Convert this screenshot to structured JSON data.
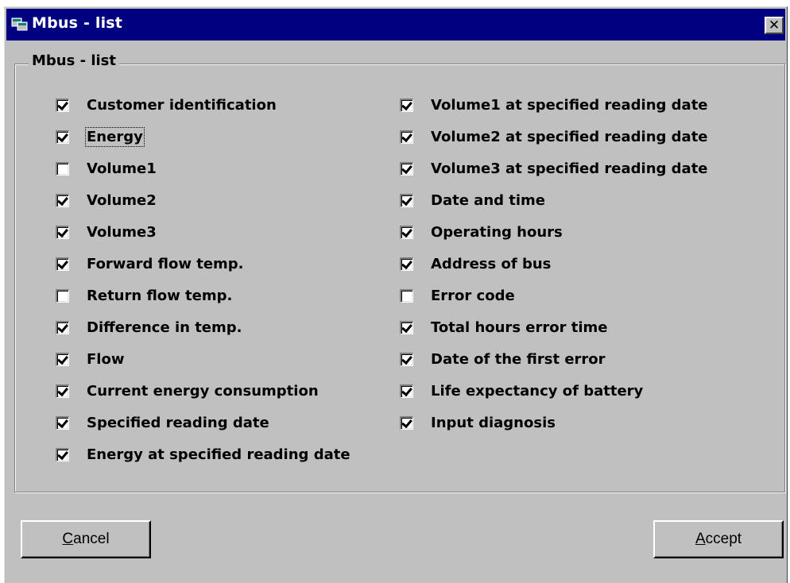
{
  "window": {
    "title": "Mbus - list",
    "icon": "app-window-icon",
    "close_label": "✕"
  },
  "group": {
    "label": "Mbus - list"
  },
  "left_column": [
    {
      "label": "Customer identification",
      "checked": true
    },
    {
      "label": "Energy",
      "checked": true,
      "focused": true
    },
    {
      "label": "Volume1",
      "checked": false
    },
    {
      "label": "Volume2",
      "checked": true
    },
    {
      "label": "Volume3",
      "checked": true
    },
    {
      "label": "Forward flow temp.",
      "checked": true
    },
    {
      "label": "Return flow temp.",
      "checked": false
    },
    {
      "label": "Difference in temp.",
      "checked": true
    },
    {
      "label": "Flow",
      "checked": true
    },
    {
      "label": "Current energy consumption",
      "checked": true
    },
    {
      "label": "Specified reading date",
      "checked": true
    },
    {
      "label": "Energy at specified reading date",
      "checked": true
    }
  ],
  "right_column": [
    {
      "label": "Volume1 at specified reading date",
      "checked": true
    },
    {
      "label": "Volume2 at specified reading date",
      "checked": true
    },
    {
      "label": "Volume3 at specified reading date",
      "checked": true
    },
    {
      "label": "Date and time",
      "checked": true
    },
    {
      "label": "Operating hours",
      "checked": true
    },
    {
      "label": "Address of bus",
      "checked": true
    },
    {
      "label": "Error code",
      "checked": false
    },
    {
      "label": "Total hours error time",
      "checked": true
    },
    {
      "label": "Date of the first error",
      "checked": true
    },
    {
      "label": "Life expectancy of battery",
      "checked": true
    },
    {
      "label": "Input diagnosis",
      "checked": true
    }
  ],
  "buttons": {
    "cancel": {
      "mnemonic": "C",
      "rest": "ancel"
    },
    "accept": {
      "mnemonic": "A",
      "rest": "ccept"
    }
  },
  "colors": {
    "titlebar": "#000080",
    "face": "#c0c0c0"
  }
}
